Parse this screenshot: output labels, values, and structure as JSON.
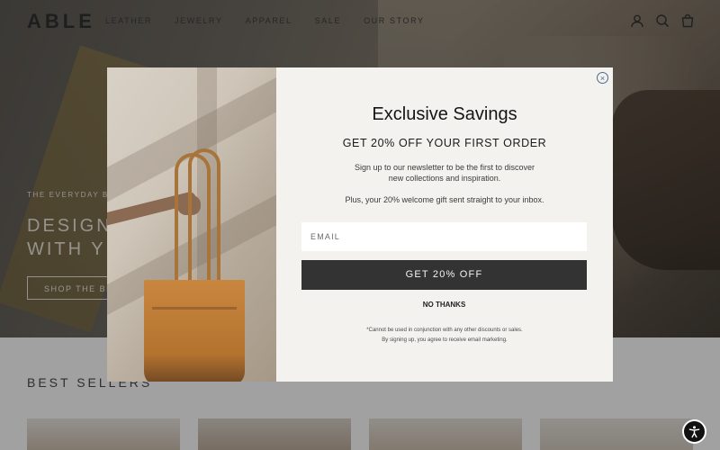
{
  "brand": {
    "logo": "ABLE"
  },
  "nav": {
    "items": [
      "LEATHER",
      "JEWELRY",
      "APPAREL",
      "SALE",
      "OUR STORY"
    ]
  },
  "header_icons": [
    "account-icon",
    "search-icon",
    "cart-icon"
  ],
  "hero": {
    "eyebrow": "THE EVERYDAY BE",
    "heading_line1": "DESIGN",
    "heading_line2": "WITH Y",
    "button": "SHOP THE BE"
  },
  "best_sellers": {
    "title": "BEST SELLERS"
  },
  "modal": {
    "close_icon": "×",
    "title": "Exclusive Savings",
    "subtitle": "GET 20% OFF YOUR FIRST ORDER",
    "body_line1": "Sign up to our newsletter to be the first to discover",
    "body_line2": "new collections and inspiration.",
    "body_line3": "Plus, your 20% welcome gift sent straight to your inbox.",
    "email_placeholder": "EMAIL",
    "cta": "GET 20% OFF",
    "no_thanks": "NO THANKS",
    "fine_print_1": "*Cannot be used in conjunction with any other discounts or sales.",
    "fine_print_2": "By signing up, you agree to receive email marketing."
  },
  "colors": {
    "cta_bg": "#333333",
    "modal_bg": "#f3f2ef",
    "bag": "#b9773a"
  }
}
